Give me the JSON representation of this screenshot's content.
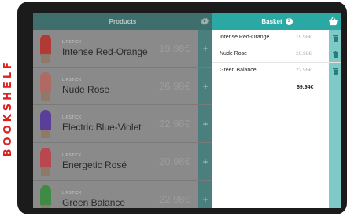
{
  "side_label": "BOOKSHELF",
  "colors": {
    "products_header": "#3e6f6d",
    "basket_header": "#2aa9a4",
    "add_button": "#4a7f7d",
    "delete_button": "#7fc9c6"
  },
  "products": {
    "header": "Products",
    "settings_icon": "gear-icon",
    "items": [
      {
        "category": "LIPSTICK",
        "name": "Intense Red-Orange",
        "price": "19.98€",
        "color": "#b23a35",
        "add": "+"
      },
      {
        "category": "LIPSTICK",
        "name": "Nude Rose",
        "price": "26.98€",
        "color": "#b06a63",
        "add": "+"
      },
      {
        "category": "LIPSTICK",
        "name": "Electric Blue-Violet",
        "price": "22.98€",
        "color": "#5a3f9a",
        "add": "+"
      },
      {
        "category": "LIPSTICK",
        "name": "Energetic Rosé",
        "price": "20.98€",
        "color": "#b8474f",
        "add": "+"
      },
      {
        "category": "LIPSTICK",
        "name": "Green Balance",
        "price": "22.98€",
        "color": "#3f8a45",
        "add": "+"
      }
    ]
  },
  "basket": {
    "header": "Basket",
    "count": "3",
    "cart_icon": "basket-icon",
    "items": [
      {
        "name": "Intense Red-Orange",
        "price": "19.98€"
      },
      {
        "name": "Nude Rose",
        "price": "26.98€"
      },
      {
        "name": "Green Balance",
        "price": "22.98€"
      }
    ],
    "total": "69.94€"
  }
}
